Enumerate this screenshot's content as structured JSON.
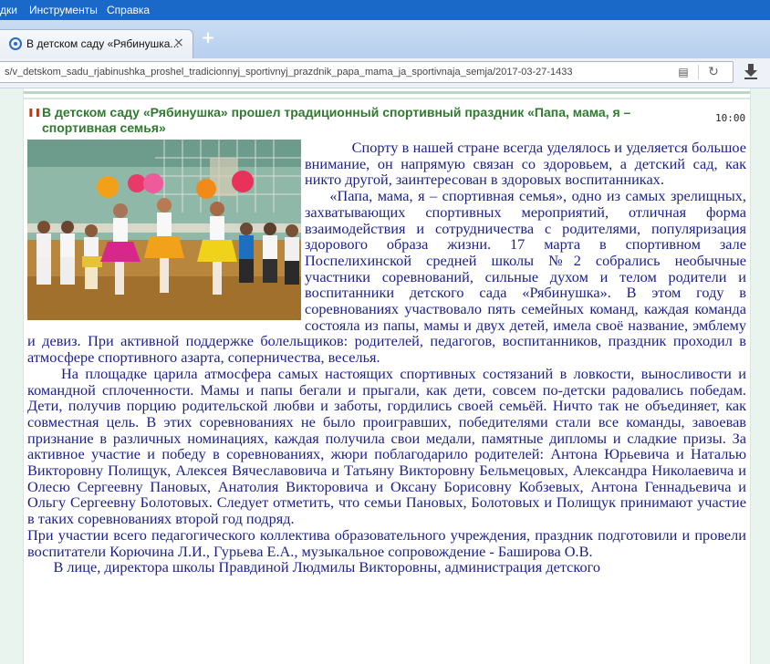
{
  "browser": {
    "menu": [
      "дки",
      "Инструменты",
      "Справка"
    ],
    "tab_title": "В детском саду «Рябинушка...",
    "tab_close": "×",
    "new_tab": "+",
    "url": "s/v_detskom_sadu_rjabinushka_proshel_tradicionnyj_sportivnyj_prazdnik_papa_mama_ja_sportivnaja_semja/2017-03-27-1433"
  },
  "article": {
    "title": "В детском саду «Рябинушка» прошел традиционный спортивный праздник «Папа, мама, я – спортивная семья»",
    "time": "10:00",
    "paragraphs": [
      "            Спорту в нашей стране всегда уделялось и уделяется большое внимание, он напрямую связан со здоровьем, а детский сад, как никто другой, заинтересован в здоровых воспитанниках.",
      "     «Папа, мама, я – спортивная семья», одно из самых зрелищных, захватывающих спортивных мероприятий, отличная форма взаимодействия и сотрудничества с родителями, популяризация здорового образа жизни. 17 марта в спортивном зале Поспелихинской средней школы №2 собрались необычные участники соревнований, сильные духом и телом родители и воспитанники детского сада «Рябинушка». В этом году в соревнованиях участвовало пять семейных команд, каждая команда состояла из папы, мамы и двух детей, имела своё название, эмблему и девиз. При активной поддержке болельщиков: родителей, педагогов, воспитанников, праздник проходил в атмосфере спортивного азарта, соперничества, веселья.",
      "     На площадке царила атмосфера самых настоящих спортивных состязаний в ловкости, выносливости и командной сплоченности. Мамы и папы бегали и прыгали, как дети, совсем по-детски радовались победам. Дети, получив порцию родительской любви и заботы, гордились своей семьёй. Ничто так не объединяет, как совместная цель. В этих соревнованиях не было проигравших, победителями стали все команды, завоевав признание в различных номинациях, каждая получила свои медали, памятные дипломы и сладкие призы. За активное участие и победу в соревнованиях, жюри поблагодарило родителей: Антона Юрьевича и Наталью Викторовну Полищук, Алексея Вячеславовича и Татьяну Викторовну Бельмецовых, Александра Николаевича и Олесю Сергеевну Пановых, Анатолия Викторовича и Оксану Борисовну Кобзевых, Антона Геннадьевича и Ольгу Сергеевну Болотовых. Следует отметить, что семьи Пановых, Болотовых и Полищук принимают участие в таких соревнованиях второй год подряд.",
      "При участии всего педагогического коллектива образовательного учреждения, праздник подготовили и провели воспитатели Корючина Л.И., Гурьева Е.А., музыкальное сопровождение - Баширова О.В.",
      "       В лице, директора школы Правдиной Людмилы Викторовны, администрация детского"
    ]
  },
  "icons": {
    "favicon": "site-favicon-icon",
    "reader": "reader-view-icon",
    "reload": "reload-icon",
    "download": "download-arrow-icon",
    "bullet": "title-bullet-icon"
  }
}
